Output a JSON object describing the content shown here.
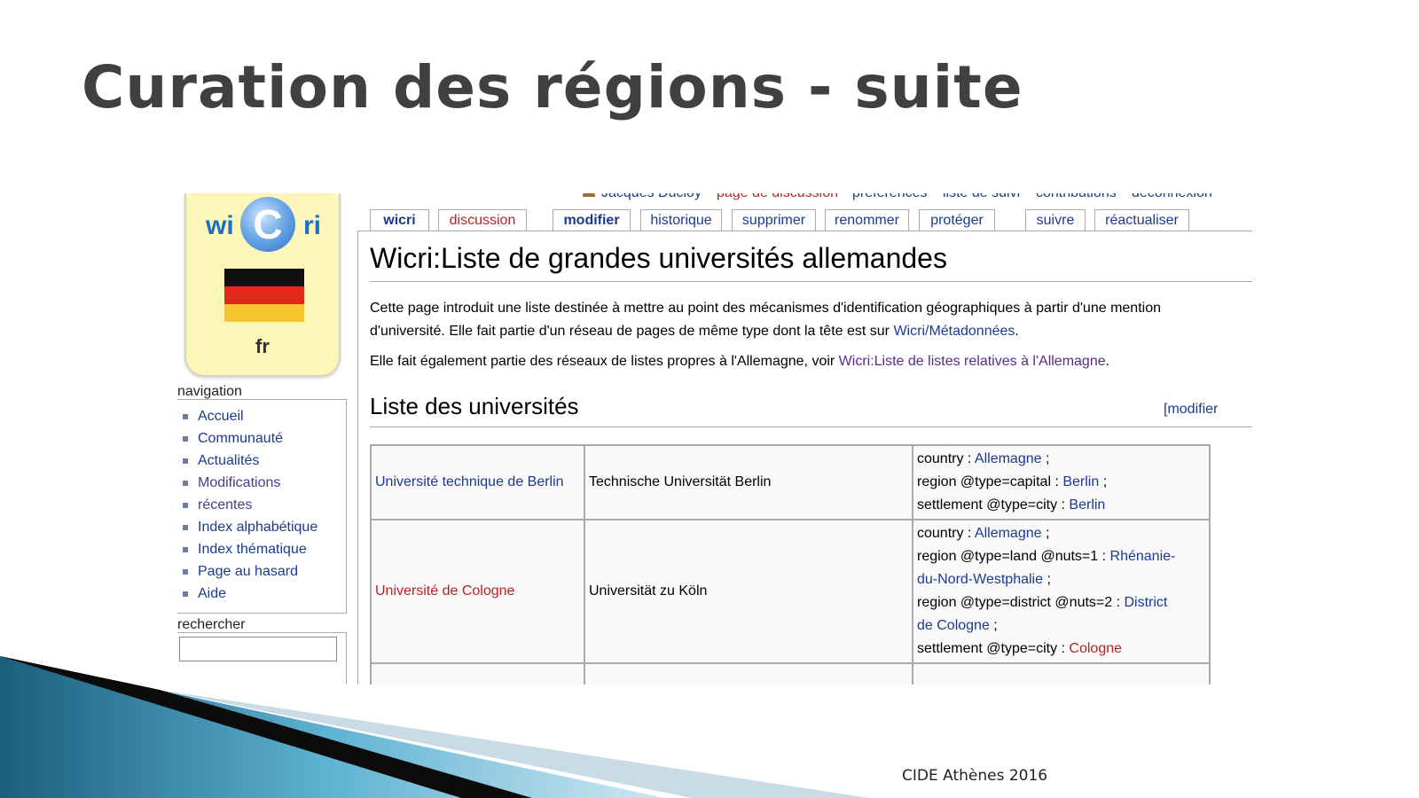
{
  "slide": {
    "title": "Curation des régions - suite",
    "footer": "CIDE Athènes 2016"
  },
  "logo": {
    "left_text": "wi",
    "circle_text": "C",
    "right_text": "ri",
    "lang": "fr"
  },
  "personal_bar": {
    "user": "Jacques Ducloy",
    "items": [
      "page de discussion",
      "préférences",
      "liste de suivi",
      "contributions",
      "déconnexion"
    ]
  },
  "tabs": [
    "wicri",
    "discussion",
    "modifier",
    "historique",
    "supprimer",
    "renommer",
    "protéger",
    "suivre",
    "réactualiser"
  ],
  "sidebar": {
    "nav_heading": "navigation",
    "nav_items": [
      "Accueil",
      "Communauté",
      "Actualités",
      "Modifications",
      "récentes",
      "Index alphabétique",
      "Index thématique",
      "Page au hasard",
      "Aide"
    ],
    "search_heading": "rechercher",
    "search_value": ""
  },
  "article": {
    "title": "Wicri:Liste de grandes universités allemandes",
    "intro_line1": "Cette page introduit une liste destinée à mettre au point des mécanismes d'identification géographiques à partir d'une mention",
    "intro_line2_text": "d'université. Elle fait partie d'un réseau de pages de même type dont la tête est sur ",
    "intro_line2_link": "Wicri/Métadonnées",
    "intro_line2_end": ".",
    "intro_line3_text": "Elle fait également partie des réseaux de listes propres à l'Allemagne, voir ",
    "intro_line3_link": "Wicri:Liste de listes relatives à l'Allemagne",
    "intro_line3_end": ".",
    "section_title": "Liste des universités",
    "section_edit": "[modifier"
  },
  "table": {
    "rows": [
      {
        "fr_name": "Université technique de Berlin",
        "de_name": "Technische Universität Berlin",
        "meta": {
          "country_label": "country : ",
          "country": "Allemagne",
          "country_end": " ;",
          "region_label": "region @type=capital : ",
          "region": "Berlin",
          "region_end": " ;",
          "settlement_label": "settlement @type=city : ",
          "settlement": "Berlin"
        }
      },
      {
        "fr_name": "Université de Cologne",
        "de_name": "Universität zu Köln",
        "meta": {
          "country_label": "country : ",
          "country": "Allemagne",
          "country_end": " ;",
          "region1_label": "region @type=land @nuts=1 : ",
          "region1_a": "Rhénanie-",
          "region1_b": "du-Nord-Westphalie",
          "region1_end": " ;",
          "region2_label": "region @type=district @nuts=2 : ",
          "region2_a": "District",
          "region2_b": "de Cologne",
          "region2_end": " ;",
          "settlement_label": "settlement @type=city : ",
          "settlement": "Cologne"
        }
      }
    ]
  },
  "colors": {
    "link": "#1a3a8f",
    "link_new": "#ba2222",
    "visited": "#5a2a8a",
    "title_gray": "#404040"
  }
}
